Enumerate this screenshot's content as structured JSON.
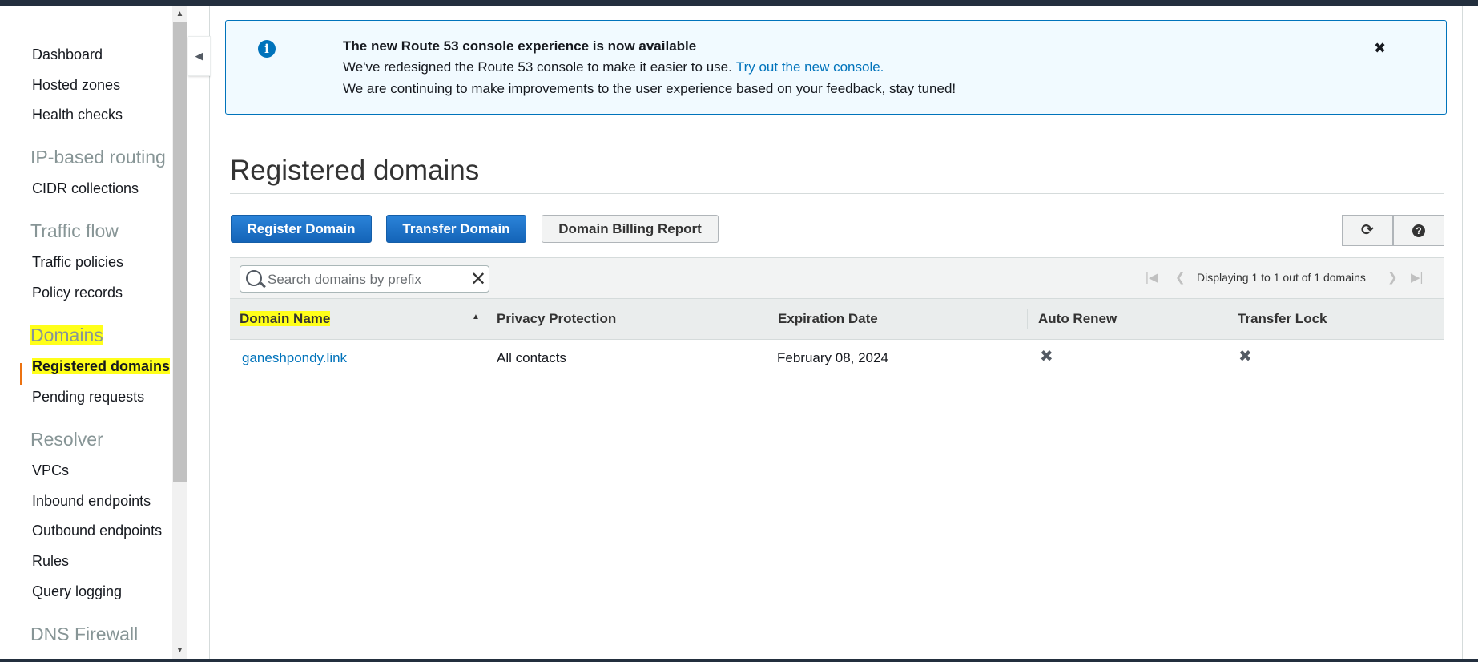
{
  "sidebar": {
    "items": [
      {
        "label": "Dashboard"
      },
      {
        "label": "Hosted zones"
      },
      {
        "label": "Health checks"
      },
      {
        "section": "IP-based routing"
      },
      {
        "label": "CIDR collections"
      },
      {
        "section": "Traffic flow"
      },
      {
        "label": "Traffic policies"
      },
      {
        "label": "Policy records"
      },
      {
        "section": "Domains"
      },
      {
        "label": "Registered domains",
        "active": true
      },
      {
        "label": "Pending requests"
      },
      {
        "section": "Resolver"
      },
      {
        "label": "VPCs"
      },
      {
        "label": "Inbound endpoints"
      },
      {
        "label": "Outbound endpoints"
      },
      {
        "label": "Rules"
      },
      {
        "label": "Query logging"
      },
      {
        "section": "DNS Firewall"
      }
    ],
    "highlight_color": "#ffff1a",
    "active_indicator_color": "#ec7211"
  },
  "flash": {
    "title": "The new Route 53 console experience is now available",
    "line2": "We've redesigned the Route 53 console to make it easier to use.",
    "link": "Try out the new console.",
    "line3": "We are continuing to make improvements to the user experience based on your feedback, stay tuned!",
    "icon": "info-icon",
    "close_icon": "close-icon"
  },
  "page": {
    "title": "Registered domains"
  },
  "toolbar": {
    "register_label": "Register Domain",
    "transfer_label": "Transfer Domain",
    "billing_label": "Domain Billing Report",
    "refresh_icon": "refresh-icon",
    "help_icon": "help-icon"
  },
  "search": {
    "placeholder": "Search domains by prefix",
    "value": ""
  },
  "pagination": {
    "text": "Displaying 1 to 1 out of 1 domains"
  },
  "table": {
    "columns": [
      "Domain Name",
      "Privacy Protection",
      "Expiration Date",
      "Auto Renew",
      "Transfer Lock"
    ],
    "rows": [
      {
        "domain": "ganeshpondy.link",
        "privacy": "All contacts",
        "expiration": "February 08, 2024",
        "auto_renew": "off",
        "transfer_lock": "off"
      }
    ]
  }
}
